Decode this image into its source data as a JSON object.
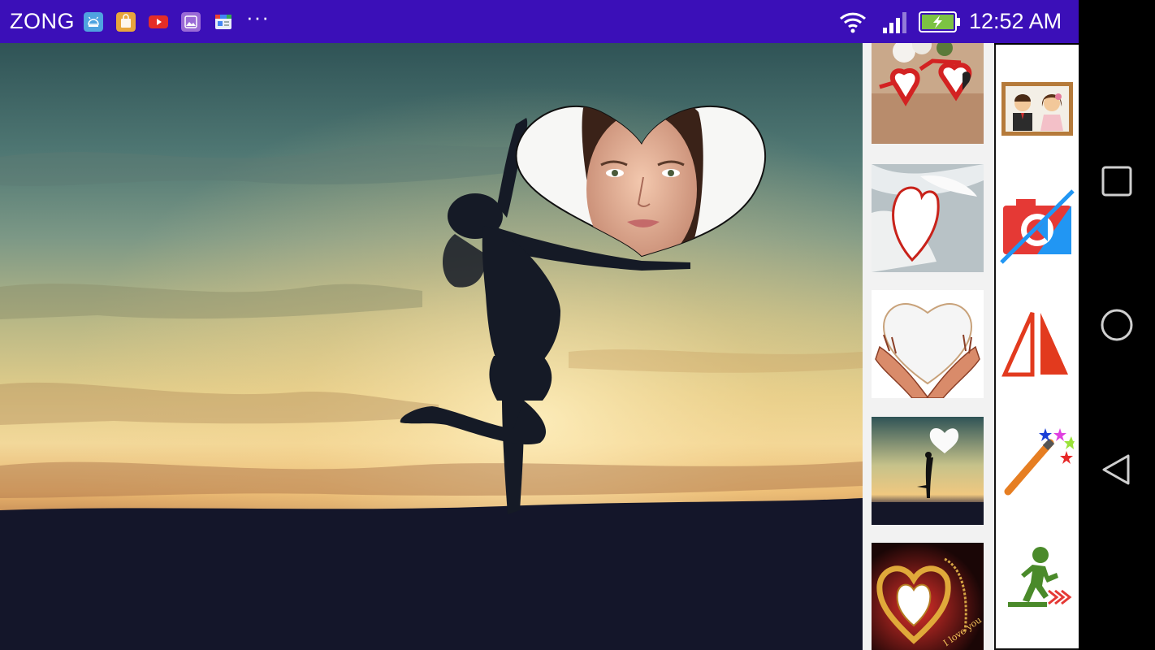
{
  "status_bar": {
    "carrier": "ZONG",
    "time": "12:52 AM",
    "more": "···",
    "notification_icons": [
      "android-debug-icon",
      "shopping-bag-icon",
      "youtube-icon",
      "gallery-icon",
      "google-news-icon"
    ],
    "system_icons": [
      "wifi-icon",
      "signal-icon",
      "battery-charging-icon"
    ],
    "background_color": "#3b0fb8"
  },
  "canvas": {
    "background_photo": "silhouette-girl-sunset",
    "frame_overlay": "heart-frame",
    "frame_photo": "woman-face"
  },
  "frames": [
    {
      "id": "frame-sunglasses",
      "description": "heart-sunglasses"
    },
    {
      "id": "frame-feather",
      "description": "feather-heart"
    },
    {
      "id": "frame-hands",
      "description": "hands-holding-heart"
    },
    {
      "id": "frame-silhouette",
      "description": "silhouette-sunset"
    },
    {
      "id": "frame-gold-heart",
      "description": "gold-heart-chain"
    }
  ],
  "gold_heart_text": "I love you",
  "tools": [
    "couple-photo-icon",
    "camera-off-icon",
    "flip-icon",
    "magic-wand-icon",
    "exit-icon"
  ],
  "colors": {
    "accent_red": "#e53935",
    "accent_blue": "#2196f3",
    "tool_orange": "#e67e22",
    "tool_green": "#4a8a2a",
    "nav_bar": "#000000"
  }
}
